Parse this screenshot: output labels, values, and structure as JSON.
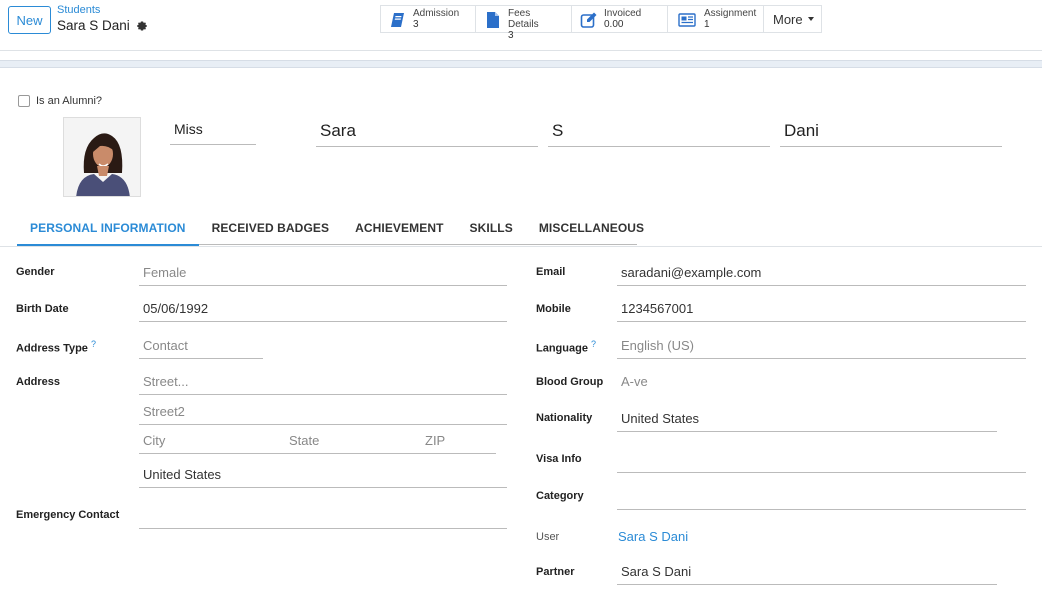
{
  "header": {
    "new_label": "New",
    "breadcrumb_parent": "Students",
    "breadcrumb_current": "Sara S Dani"
  },
  "smart_buttons": [
    {
      "label": "Admission",
      "value": "3",
      "icon": "book-icon"
    },
    {
      "label": "Fees Details",
      "value": "3",
      "icon": "file-icon"
    },
    {
      "label": "Invoiced",
      "value": "0.00",
      "icon": "edit-icon"
    },
    {
      "label": "Assignment",
      "value": "1",
      "icon": "newspaper-icon"
    }
  ],
  "more_label": "More",
  "form": {
    "alumni_label": "Is an Alumni?",
    "title": "Miss",
    "first_name": "Sara",
    "middle_name": "S",
    "last_name": "Dani"
  },
  "tabs": [
    "PERSONAL INFORMATION",
    "RECEIVED BADGES",
    "ACHIEVEMENT",
    "SKILLS",
    "MISCELLANEOUS"
  ],
  "left": {
    "gender_label": "Gender",
    "gender": "Female",
    "birth_label": "Birth Date",
    "birth": "05/06/1992",
    "addr_type_label": "Address Type",
    "addr_type": "Contact",
    "address_label": "Address",
    "street_ph": "Street...",
    "street2_ph": "Street2",
    "city_ph": "City",
    "state_ph": "State",
    "zip_ph": "ZIP",
    "country": "United States",
    "emergency_label": "Emergency Contact"
  },
  "right": {
    "email_label": "Email",
    "email": "saradani@example.com",
    "mobile_label": "Mobile",
    "mobile": "1234567001",
    "language_label": "Language",
    "language": "English (US)",
    "blood_label": "Blood Group",
    "blood": "A-ve",
    "nationality_label": "Nationality",
    "nationality": "United States",
    "visa_label": "Visa Info",
    "category_label": "Category",
    "user_label": "User",
    "user": "Sara S Dani",
    "partner_label": "Partner",
    "partner": "Sara S Dani"
  },
  "help_mark": "?"
}
